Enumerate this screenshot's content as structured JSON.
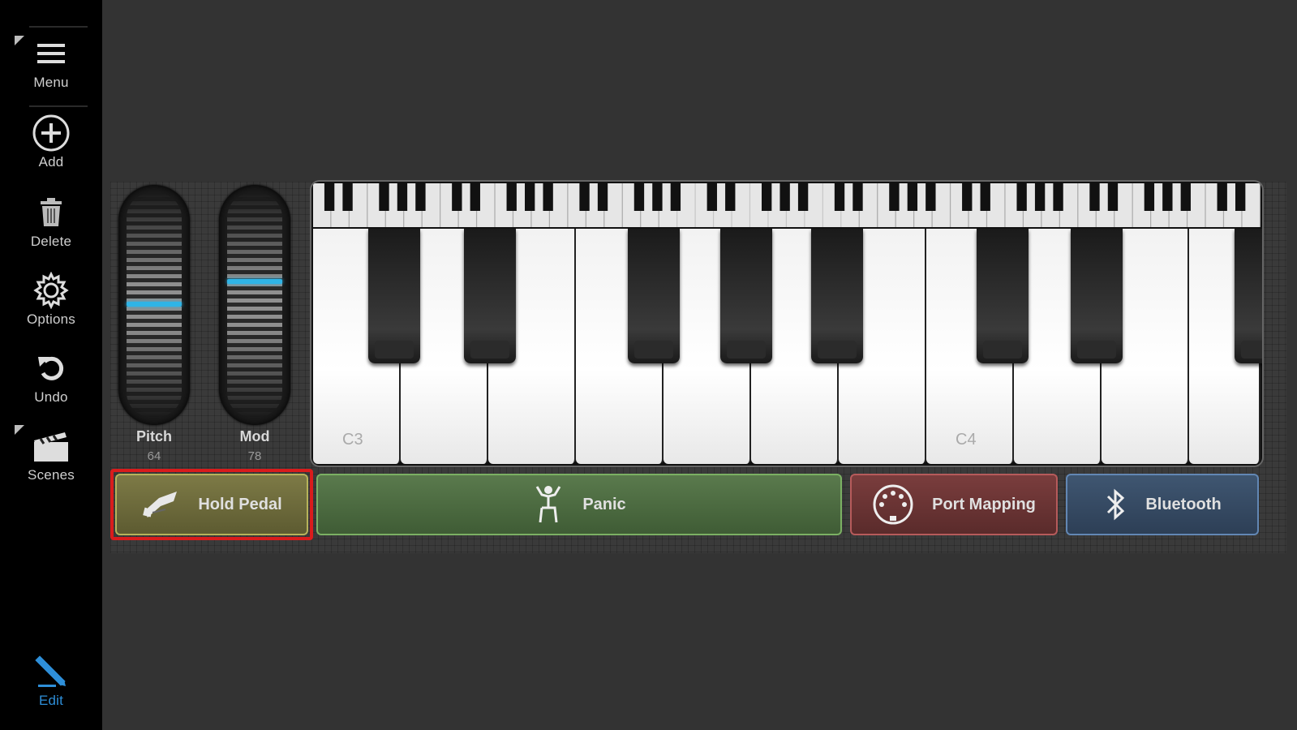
{
  "sidebar": {
    "menu_label": "Menu",
    "add_label": "Add",
    "delete_label": "Delete",
    "options_label": "Options",
    "undo_label": "Undo",
    "scenes_label": "Scenes",
    "edit_label": "Edit"
  },
  "controls": {
    "pitch": {
      "label": "Pitch",
      "value": "64"
    },
    "mod": {
      "label": "Mod",
      "value": "78"
    }
  },
  "keyboard": {
    "note_labels": [
      "C3",
      "C4"
    ]
  },
  "buttons": {
    "hold_pedal": "Hold Pedal",
    "panic": "Panic",
    "port_mapping": "Port Mapping",
    "bluetooth": "Bluetooth"
  },
  "colors": {
    "accent_blue": "#2fb4e6",
    "selection_red": "#d91c1c"
  }
}
